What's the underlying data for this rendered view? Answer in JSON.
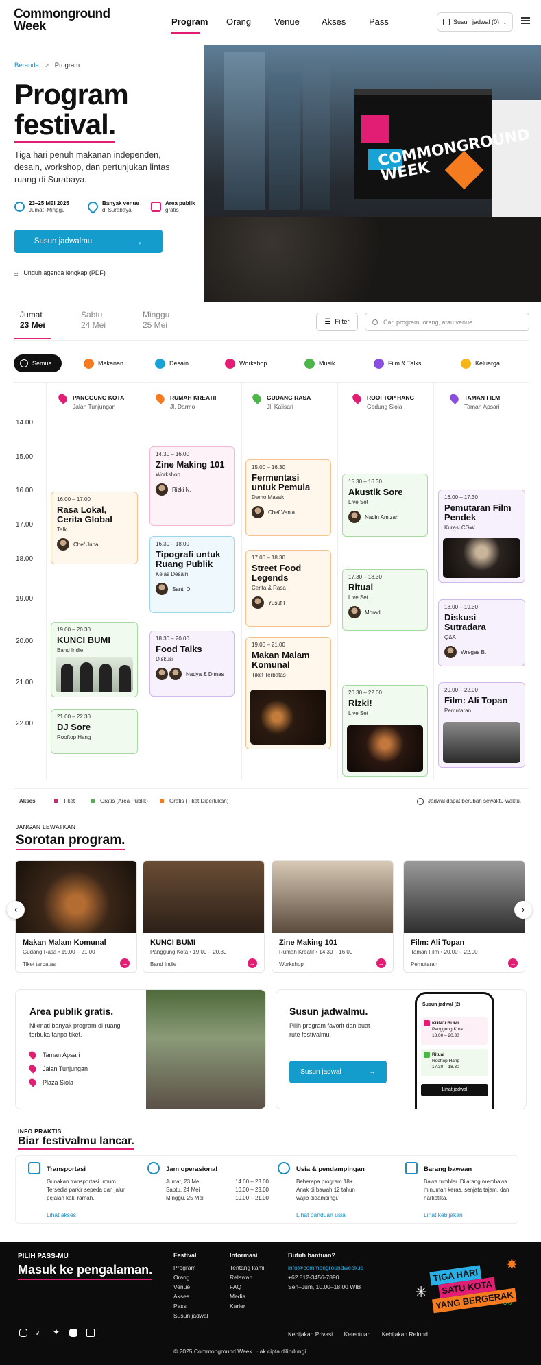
{
  "brand": {
    "logo_line1": "Commonground",
    "logo_line2": "Week"
  },
  "nav": {
    "items": [
      "Program",
      "Orang",
      "Venue",
      "Akses",
      "Pass"
    ],
    "schedule_btn": "Susun jadwal (0)"
  },
  "breadcrumb": {
    "home": "Beranda",
    "sep": ">",
    "current": "Program"
  },
  "hero": {
    "title_line1": "Program",
    "title_line2": "festival.",
    "desc": "Tiga hari penuh makanan independen, desain, workshop, dan pertunjukan lintas ruang di Surabaya.",
    "info": [
      {
        "title": "23–25 MEI 2025",
        "sub": "Jumat–Minggu"
      },
      {
        "title": "Banyak venue",
        "sub": "di Surabaya"
      },
      {
        "title": "Area publik",
        "sub": "gratis"
      }
    ],
    "cta": "Susun jadwalmu",
    "cta_arrow": "→",
    "download": "Unduh agenda lengkap (PDF)",
    "stage_text": "COMMONGROUND WEEK"
  },
  "days": [
    {
      "name": "Jumat",
      "date": "23 Mei"
    },
    {
      "name": "Sabtu",
      "date": "24 Mei"
    },
    {
      "name": "Minggu",
      "date": "25 Mei"
    }
  ],
  "filter_label": "Filter",
  "search_placeholder": "Cari program, orang, atau venue",
  "categories": [
    {
      "label": "Semua",
      "color": "#111111"
    },
    {
      "label": "Makanan",
      "color": "#f47b20"
    },
    {
      "label": "Desain",
      "color": "#17a3d6"
    },
    {
      "label": "Workshop",
      "color": "#e11d74"
    },
    {
      "label": "Musik",
      "color": "#4cb648"
    },
    {
      "label": "Film & Talks",
      "color": "#8b4fe0"
    },
    {
      "label": "Keluarga",
      "color": "#f4b51b"
    }
  ],
  "venues": [
    {
      "name": "PANGGUNG KOTA",
      "loc": "Jalan Tunjungan",
      "color": "#e11d74"
    },
    {
      "name": "RUMAH KREATIF",
      "loc": "Jl. Darmo",
      "color": "#f47b20"
    },
    {
      "name": "GUDANG RASA",
      "loc": "Jl. Kalisari",
      "color": "#4cb648"
    },
    {
      "name": "ROOFTOP HANG",
      "loc": "Gedung Siola",
      "color": "#e11d74"
    },
    {
      "name": "TAMAN FILM",
      "loc": "Taman Apsari",
      "color": "#8b4fe0"
    }
  ],
  "times": [
    "14.00",
    "15.00",
    "16.00",
    "17.00",
    "18.00",
    "19.00",
    "20.00",
    "21.00",
    "22.00"
  ],
  "events": [
    {
      "time": "16.00 – 17.00",
      "name": "Rasa Lokal, Cerita Global",
      "sub": "Talk",
      "person": "Chef Juna"
    },
    {
      "time": "19.00 – 20.30",
      "name": "KUNCI BUMI",
      "sub": "Band Indie"
    },
    {
      "time": "21.00 – 22.30",
      "name": "DJ Sore",
      "sub": "Rooftop Hang"
    },
    {
      "time": "14.30 – 16.00",
      "name": "Zine Making 101",
      "sub": "Workshop",
      "person": "Rizki N."
    },
    {
      "time": "16.30 – 18.00",
      "name": "Tipografi untuk Ruang Publik",
      "sub": "Kelas Desain",
      "person": "Santi D."
    },
    {
      "time": "18.30 – 20.00",
      "name": "Food Talks",
      "sub": "Diskusi",
      "person": "Nadya & Dimas"
    },
    {
      "time": "15.00 – 16.30",
      "name": "Fermentasi untuk Pemula",
      "sub": "Demo Masak",
      "person": "Chef Vania"
    },
    {
      "time": "17.00 – 18.30",
      "name": "Street Food Legends",
      "sub": "Cerita & Rasa",
      "person": "Yusuf F."
    },
    {
      "time": "19.00 – 21.00",
      "name": "Makan Malam Komunal",
      "sub": "Tiket Terbatas"
    },
    {
      "time": "15.30 – 16.30",
      "name": "Akustik Sore",
      "sub": "Live Set",
      "person": "Nadin Amizah"
    },
    {
      "time": "17.30 – 18.30",
      "name": "Ritual",
      "sub": "Live Set",
      "person": "Morad"
    },
    {
      "time": "20.30 – 22.00",
      "name": "Rizki!",
      "sub": "Live Set"
    },
    {
      "time": "16.00 – 17.30",
      "name": "Pemutaran Film Pendek",
      "sub": "Kurasi CGW"
    },
    {
      "time": "18.00 – 19.30",
      "name": "Diskusi Sutradara",
      "sub": "Q&A",
      "person": "Wregas B."
    },
    {
      "time": "20.00 – 22.00",
      "name": "Film: Ali Topan",
      "sub": "Pemutaran"
    }
  ],
  "legend": {
    "title": "Akses",
    "items": [
      {
        "label": "Tiket",
        "color": "#e11d74"
      },
      {
        "label": "Gratis (Area Publik)",
        "color": "#4cb648"
      },
      {
        "label": "Gratis (Tiket Diperlukan)",
        "color": "#f47b20"
      }
    ],
    "note": "Jadwal dapat berubah sewaktu-waktu."
  },
  "highlights": {
    "kicker": "JANGAN LEWATKAN",
    "title": "Sorotan program.",
    "cards": [
      {
        "name": "Makan Malam Komunal",
        "meta": "Gudang Rasa • 19.00 – 21.00",
        "cat": "Tiket terbatas"
      },
      {
        "name": "KUNCI BUMI",
        "meta": "Panggung Kota • 19.00 – 20.30",
        "cat": "Band Indie"
      },
      {
        "name": "Zine Making 101",
        "meta": "Rumah Kreatif • 14.30 – 16.00",
        "cat": "Workshop"
      },
      {
        "name": "Film: Ali Topan",
        "meta": "Taman Film • 20.00 – 22.00",
        "cat": "Pemutaran"
      }
    ]
  },
  "public_area": {
    "title": "Area publik gratis.",
    "desc": "Nikmati banyak program di ruang terbuka tanpa tiket.",
    "locations": [
      "Taman Apsari",
      "Jalan Tunjungan",
      "Plaza Siola"
    ]
  },
  "schedule_promo": {
    "title": "Susun jadwalmu.",
    "desc": "Pilih program favorit dan buat rute festivalmu.",
    "btn": "Susun jadwal",
    "phone_header": "Susun jadwal (2)",
    "phone_items": [
      {
        "name": "KUNCI BUMI",
        "loc": "Panggung Kota",
        "time": "18.00 – 20.30"
      },
      {
        "name": "Ritual",
        "loc": "Rooftop Hang",
        "time": "17.30 – 18.30"
      }
    ],
    "phone_btn": "Lihat jadwal"
  },
  "practical": {
    "kicker": "INFO PRAKTIS",
    "title": "Biar festivalmu lancar.",
    "cards": [
      {
        "title": "Transportasi",
        "body": "Gunakan transportasi umum. Tersedia parkir sepeda dan jalur pejalan kaki ramah.",
        "link": "Lihat akses"
      },
      {
        "title": "Jam operasional",
        "rows": [
          [
            "Jumat, 23 Mei",
            "14.00 – 23.00"
          ],
          [
            "Sabtu, 24 Mei",
            "10.00 – 23.00"
          ],
          [
            "Minggu, 25 Mei",
            "10.00 – 21.00"
          ]
        ]
      },
      {
        "title": "Usia & pendampingan",
        "body": "Beberapa program 18+. Anak di bawah 12 tahun wajib didampingi.",
        "link": "Lihat panduan usia"
      },
      {
        "title": "Barang bawaan",
        "body": "Bawa tumbler. Dilarang membawa minuman keras, senjata tajam, dan narkotika.",
        "link": "Lihat kebijakan"
      }
    ]
  },
  "footer": {
    "kicker": "PILIH PASS-MU",
    "title": "Masuk ke pengalaman.",
    "col1_title": "Festival",
    "col1": [
      "Program",
      "Orang",
      "Venue",
      "Akses",
      "Pass",
      "Susun jadwal"
    ],
    "col2_title": "Informasi",
    "col2": [
      "Tentang kami",
      "Relawan",
      "FAQ",
      "Media",
      "Karier"
    ],
    "help_title": "Butuh bantuan?",
    "email": "info@commongroundweek.id",
    "phone": "+62 812-3456-7890",
    "hours": "Sen–Jum, 10.00–18.00 WIB",
    "badge": [
      "TIGA HARI",
      "SATU KOTA",
      "YANG BERGERAK"
    ],
    "legal": [
      "Kebijakan Privasi",
      "Ketentuan",
      "Kebijakan Refund"
    ],
    "copyright": "© 2025 Commonground Week. Hak cipta dilindungi."
  }
}
